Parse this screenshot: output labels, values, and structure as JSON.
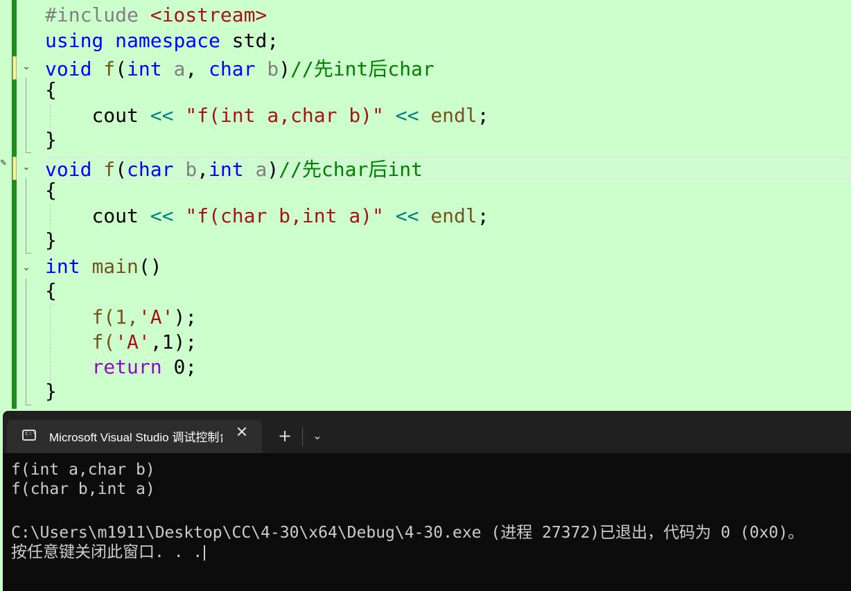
{
  "code": {
    "include_directive": "#include",
    "include_header": "<iostream>",
    "using_kw": "using",
    "namespace_kw": "namespace",
    "std": "std;",
    "void_kw": "void",
    "int_kw": "int",
    "char_kw": "char",
    "fn_f": "f",
    "param_a": "a",
    "param_b": "b",
    "comma_sp": ", ",
    "comma": ",",
    "lparen": "(",
    "rparen": ")",
    "comment1": "//先int后char",
    "comment2": "//先char后int",
    "open_brace": "{",
    "close_brace": "}",
    "cout": "cout",
    "shl": "<<",
    "str1": "\"f(int a,char b)\"",
    "str2": "\"f(char b,int a)\"",
    "endl": "endl",
    "semi": ";",
    "main_fn": "main",
    "main_parens": "()",
    "call1_open": "f(1,",
    "char_lit": "'A'",
    "call_close": ");",
    "call2_open": "f(",
    "call2_tail": ",1);",
    "return_kw": "return",
    "zero": "0;"
  },
  "terminal": {
    "tab_title": "Microsoft Visual Studio 调试控制台",
    "close_glyph": "✕",
    "new_tab_glyph": "+",
    "dropdown_glyph": "⌄",
    "icon_text": "c:\\",
    "lines": [
      "f(int a,char b)",
      "f(char b,int a)",
      "",
      "C:\\Users\\m1911\\Desktop\\CC\\4-30\\x64\\Debug\\4-30.exe (进程 27372)已退出，代码为 0 (0x0)。",
      "按任意键关闭此窗口. . ."
    ]
  },
  "colors": {
    "editor_bg": "#ccffcc",
    "terminal_bg": "#0c0c0c",
    "keyword": "#0000ff",
    "comment": "#008000",
    "string": "#a31515"
  },
  "icons": [
    "fold-chevron-icon",
    "terminal-icon",
    "close-icon",
    "plus-icon",
    "chevron-down-icon"
  ]
}
